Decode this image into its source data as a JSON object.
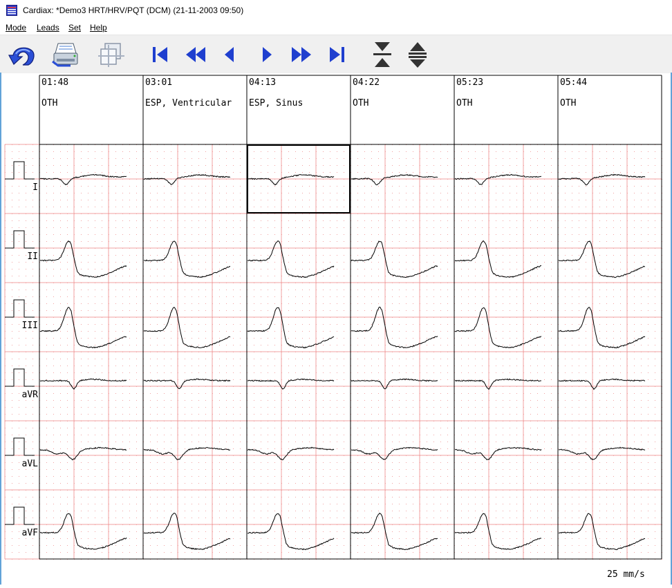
{
  "window": {
    "title": "Cardiax: *Demo3 HRT/HRV/PQT (DCM) (21-11-2003 09:50)"
  },
  "menu": [
    {
      "label": "Mode"
    },
    {
      "label": "Leads"
    },
    {
      "label": "Set"
    },
    {
      "label": "Help"
    }
  ],
  "toolbar": [
    {
      "icon": "undo-arrow-icon"
    },
    {
      "icon": "printer-icon"
    },
    {
      "icon": "overlay-icon"
    },
    {
      "icon": "first-icon"
    },
    {
      "icon": "fast-back-icon"
    },
    {
      "icon": "back-icon"
    },
    {
      "icon": "forward-icon"
    },
    {
      "icon": "fast-forward-icon"
    },
    {
      "icon": "last-icon"
    },
    {
      "icon": "compress-icon"
    },
    {
      "icon": "expand-icon"
    }
  ],
  "beats": [
    {
      "time": "01:48",
      "label": "OTH"
    },
    {
      "time": "03:01",
      "label": "ESP, Ventricular"
    },
    {
      "time": "04:13",
      "label": "ESP, Sinus"
    },
    {
      "time": "04:22",
      "label": "OTH"
    },
    {
      "time": "05:23",
      "label": "OTH"
    },
    {
      "time": "05:44",
      "label": "OTH"
    }
  ],
  "leads": [
    "I",
    "II",
    "III",
    "aVR",
    "aVL",
    "aVF"
  ],
  "selected": {
    "beat": 2,
    "lead": 0
  },
  "speed": "25 mm/s",
  "colors": {
    "grid": "#f2a0a0",
    "trace": "#000000",
    "frame": "#000000",
    "accent_border": "#62a3d8"
  }
}
